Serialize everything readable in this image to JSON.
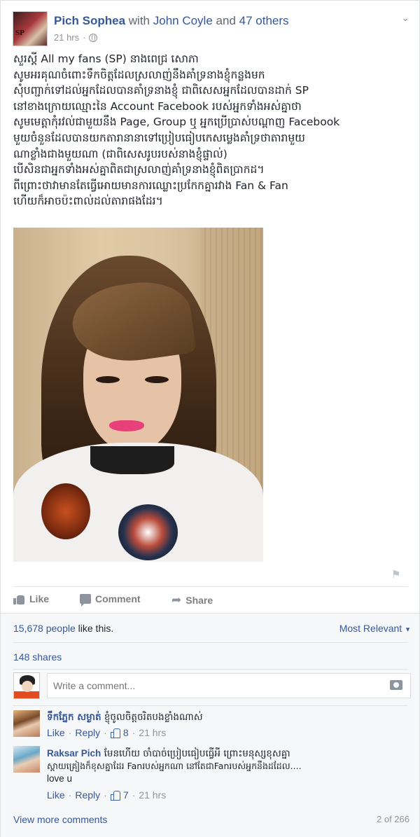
{
  "post": {
    "author": "Pich Sophea",
    "with_word": "with",
    "tagged": "John Coyle",
    "and_word": "and",
    "others": "47 others",
    "time": "21 hrs",
    "avatar_text": "SP",
    "text_lines": [
      "សួរស្តី All my fans (SP) នាងពេជ្រ សោភា",
      "សូមអរគុណចំពោះទឹកចិត្តដែលស្រលាញ់នឹងគាំទ្រនាងខ្ញុំកន្លងមក",
      "សុំបញ្ជាក់ទៅដល់អ្នកដែលបានគាំទ្រនាងខ្ញុំ ជាពិសេសអ្នកដែលបានដាក់ SP",
      "នៅខាងក្រោយឈ្មោះនៃ Account Facebook របស់អ្នកទាំងអស់គ្នាថា",
      "សូមមេត្តាកុំរវល់ជាមួយនឹង Page, Group ឬ អ្នកប្រើប្រាស់បណ្តាញ Facebook",
      "មួយចំនួនដែលបានយកតារានានាទៅប្រៀបធៀបកេសម្លេងគាំទ្រថាតារាមួយ",
      "ណាខ្លាំងជាងមួយណា (ជាពិសេសរូបរបស់នាងខ្ញុំផ្ទាល់)",
      "បើសិនជាអ្នកទាំងអស់គ្នាពិតជាស្រលាញ់គាំទ្រនាងខ្ញុំពិតប្រាកដ។",
      "ពីព្រោះថាវាមានតែធ្វើអោយមានការឈ្លោះប្រកែកគ្នារវាង Fan & Fan",
      "ហើយក៏អាចប៉ះពាល់ដល់តារាផងដែរ។"
    ]
  },
  "actions": {
    "like": "Like",
    "comment": "Comment",
    "share": "Share"
  },
  "stats": {
    "likes_number": "15,678 people",
    "likes_suffix": " like this.",
    "sort": "Most Relevant",
    "shares": "148 shares"
  },
  "composer": {
    "placeholder": "Write a comment..."
  },
  "comments": [
    {
      "author": "ទឹកភ្នែក សម្ងាត់",
      "text": " ខ្ញុំចូលចិត្តចរិតបងខ្លាំងណាស់",
      "like": "Like",
      "reply": "Reply",
      "likes": "8",
      "time": "21 hrs"
    },
    {
      "author": "Raksar Pich",
      "text_line1": " មែនហើយ ចាំបាច់ប្រៀបធៀបធ្វើអី ព្រោះមនុស្សខុសគ្នា",
      "text_line2": "ស្តាយគ្រៀងក៏ខុសគ្នាដែរ Fanរបស់អ្នកណា នៅតែជាFanរបស់អ្នកនឹងដដែល....",
      "text_line3": "love u",
      "like": "Like",
      "reply": "Reply",
      "likes": "7",
      "time": "21 hrs"
    }
  ],
  "footer": {
    "view_more": "View more comments",
    "pager": "2 of 266"
  },
  "icons": {
    "globe": "globe-icon",
    "chevron": "chevron-down-icon",
    "flag": "flag-icon",
    "like": "thumbs-up-icon",
    "comment": "comment-icon",
    "share": "share-arrow-icon",
    "camera": "camera-icon"
  },
  "colors": {
    "link": "#365899",
    "muted": "#90949c",
    "like_blue": "#4267b2",
    "background": "#e9ebee"
  }
}
